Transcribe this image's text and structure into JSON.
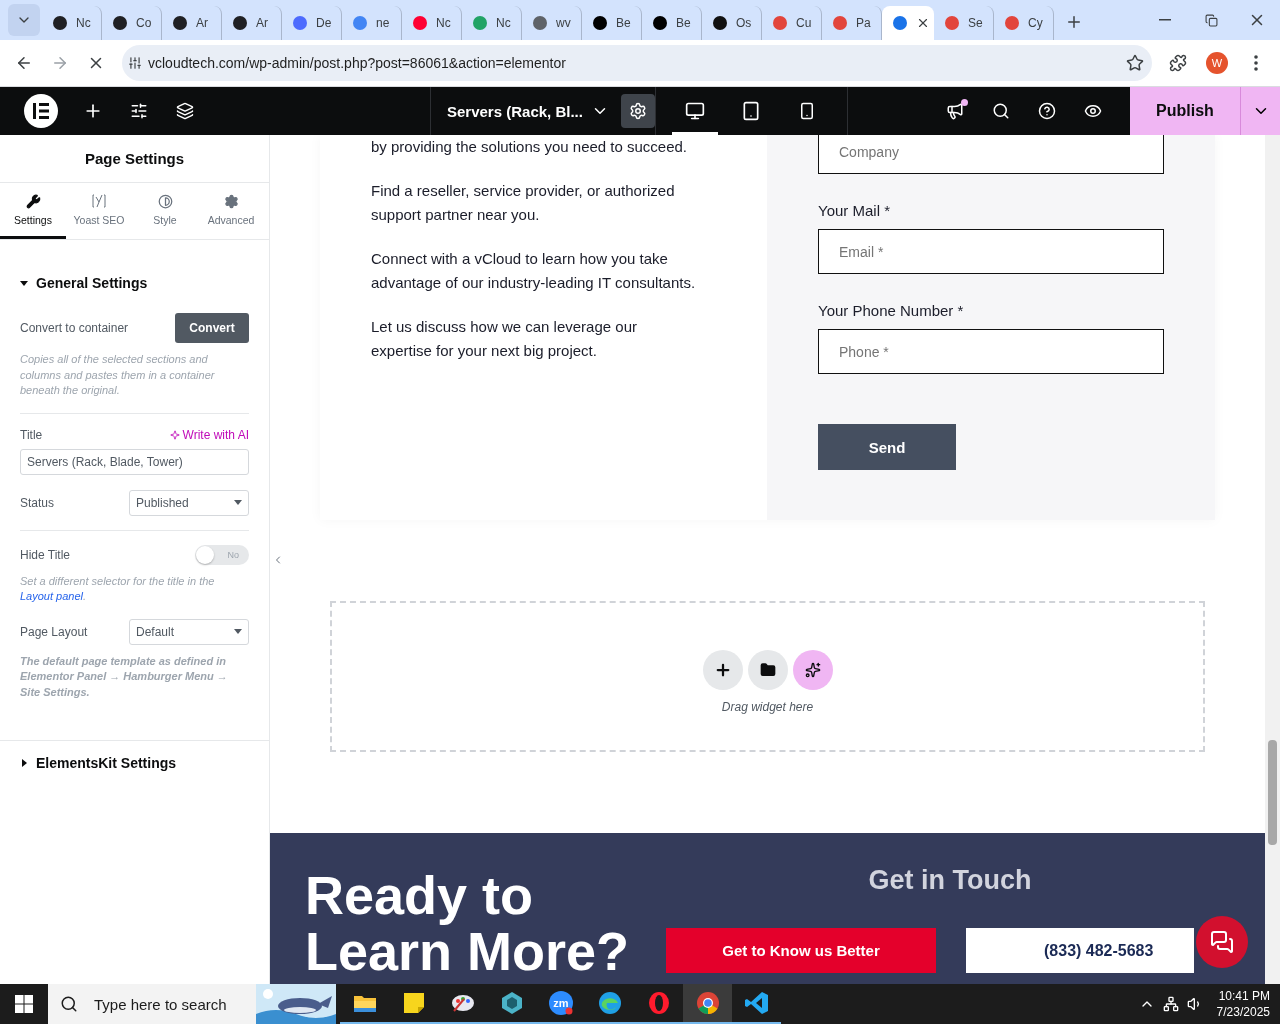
{
  "browser": {
    "tabs": [
      {
        "label": "Nc",
        "selected": false,
        "color": "#202124"
      },
      {
        "label": "Co",
        "selected": false,
        "color": "#202124"
      },
      {
        "label": "Ar",
        "selected": false,
        "color": "#202124"
      },
      {
        "label": "Ar",
        "selected": false,
        "color": "#202124"
      },
      {
        "label": "De",
        "selected": false,
        "color": "#4d6bfe"
      },
      {
        "label": "ne",
        "selected": false,
        "color": "#4285f4"
      },
      {
        "label": "Nc",
        "selected": false,
        "color": "#ff0033"
      },
      {
        "label": "Nc",
        "selected": false,
        "color": "#21a366"
      },
      {
        "label": "wv",
        "selected": false,
        "color": "#5f6368"
      },
      {
        "label": "Be",
        "selected": false,
        "color": "#000000"
      },
      {
        "label": "Be",
        "selected": false,
        "color": "#000000"
      },
      {
        "label": "Os",
        "selected": false,
        "color": "#111111"
      },
      {
        "label": "Cu",
        "selected": false,
        "color": "#e2453c"
      },
      {
        "label": "Pa",
        "selected": false,
        "color": "#e2453c"
      },
      {
        "selected": true,
        "color": "#1a73e8"
      },
      {
        "label": "Se",
        "selected": false,
        "color": "#e2453c"
      },
      {
        "label": "Cy",
        "selected": false,
        "color": "#e2453c"
      }
    ],
    "url": "vcloudtech.com/wp-admin/post.php?post=86061&action=elementor",
    "profile": "W"
  },
  "editor_bar": {
    "page_title": "Servers (Rack, Bl...",
    "devices": [
      {
        "kind": "desktop",
        "selected": true
      },
      {
        "kind": "tablet",
        "selected": false
      },
      {
        "kind": "mobile",
        "selected": false
      }
    ],
    "publish": "Publish"
  },
  "panel": {
    "title": "Page Settings",
    "tabs": [
      {
        "label": "Settings",
        "kind": "wrench",
        "selected": true
      },
      {
        "label": "Yoast SEO",
        "kind": "yoast",
        "selected": false
      },
      {
        "label": "Style",
        "kind": "contrast",
        "selected": false
      },
      {
        "label": "Advanced",
        "kind": "gear",
        "selected": false
      }
    ],
    "sections": [
      {
        "title": "General Settings",
        "expanded": true
      },
      {
        "title": "ElementsKit Settings",
        "expanded": false
      }
    ],
    "convert_label": "Convert to container",
    "convert_button": "Convert",
    "convert_note": "Copies all of the selected sections and columns and pastes them in a container beneath the original.",
    "title_label": "Title",
    "ai_link": "Write with AI",
    "title_value": "Servers (Rack, Blade, Tower)",
    "status_label": "Status",
    "status_value": "Published",
    "hide_title_label": "Hide Title",
    "hide_title": {
      "on": false,
      "label": "No"
    },
    "hide_note": "Set a different selector for the title in the",
    "hide_note_link": "Layout panel",
    "hide_note_end": ".",
    "layout_label": "Page Layout",
    "layout_value": "Default",
    "layout_note": "The default page template as defined in Elementor Panel → Hamburger Menu → Site Settings."
  },
  "canvas": {
    "paragraphs": [
      "by providing the solutions you need to succeed.",
      "Find a reseller, service provider, or authorized support partner near you.",
      "Connect with a vCloud to learn how you take advantage of our industry-leading IT consultants.",
      "Let us discuss how we can leverage our expertise for your next big project."
    ],
    "company_placeholder": "Company",
    "fields": [
      {
        "label": "Your Mail *",
        "placeholder": "Email *"
      },
      {
        "label": "Your Phone Number *",
        "placeholder": "Phone *"
      }
    ],
    "send": "Send",
    "drop_hint": "Drag widget here",
    "footer": {
      "heading": "Ready to Learn More?",
      "subheading": "Get in Touch",
      "primary": "Get to Know us Better",
      "phone": "(833) 482-5683"
    }
  },
  "taskbar": {
    "search_placeholder": "Type here to search",
    "apps": [
      {
        "kind": "folder",
        "selected": false
      },
      {
        "kind": "notes",
        "selected": false
      },
      {
        "kind": "paint",
        "selected": false
      },
      {
        "kind": "gem",
        "selected": false
      },
      {
        "kind": "zoom",
        "label": "zm",
        "selected": false
      },
      {
        "kind": "edge",
        "selected": false
      },
      {
        "kind": "opera",
        "selected": false
      },
      {
        "kind": "chrome",
        "selected": true
      },
      {
        "kind": "vscode",
        "selected": false
      }
    ],
    "time": "10:41 PM",
    "date": "7/23/2025"
  }
}
